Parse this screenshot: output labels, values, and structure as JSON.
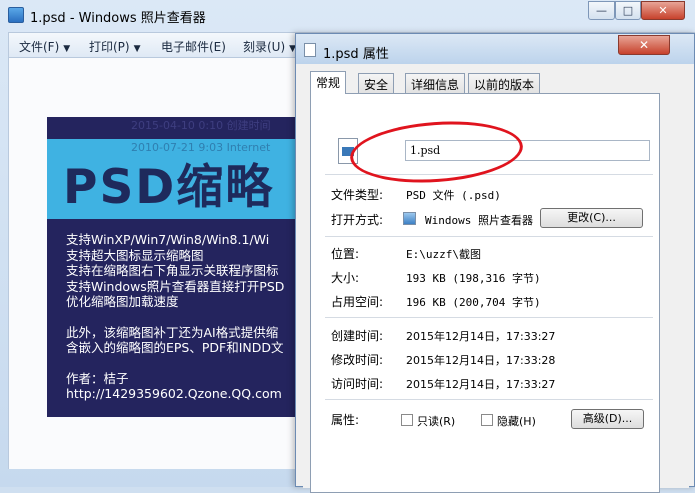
{
  "viewer": {
    "title": "1.psd - Windows 照片查看器",
    "window_buttons": {
      "minimize": "—",
      "maximize": "□",
      "close": "✕"
    },
    "menu": [
      {
        "label": "文件(F)",
        "arrow": "▼"
      },
      {
        "label": "打印(P)",
        "arrow": "▼"
      },
      {
        "label": "电子邮件(E)",
        "arrow": ""
      },
      {
        "label": "刻录(U)",
        "arrow": "▼"
      }
    ]
  },
  "thumbnail": {
    "date1": "2015-04-10 0:10    创建时间",
    "date2": "2010-07-21 9:03    Internet",
    "big_text": "PSD缩略",
    "lines": [
      "支持WinXP/Win7/Win8/Win8.1/Wi",
      "支持超大图标显示缩略图",
      "支持在缩略图右下角显示关联程序图标",
      "支持Windows照片查看器直接打开PSD",
      "优化缩略图加载速度"
    ],
    "lines2": [
      "此外，该缩略图补丁还为AI格式提供缩",
      "含嵌入的缩略图的EPS、PDF和INDD文"
    ],
    "lines3": [
      "作者：桔子",
      "http://1429359602.Qzone.QQ.com"
    ]
  },
  "dialog": {
    "title": "1.psd 属性",
    "close": "✕",
    "tabs": [
      "常规",
      "安全",
      "详细信息",
      "以前的版本"
    ],
    "filename": "1.psd",
    "file_type_label": "文件类型:",
    "file_type_value": "PSD 文件 (.psd)",
    "opens_with_label": "打开方式:",
    "opens_with_value": "Windows 照片查看器",
    "change_button": "更改(C)...",
    "location_label": "位置:",
    "location_value": "E:\\uzzf\\截图",
    "size_label": "大小:",
    "size_value": "193 KB (198,316 字节)",
    "size_on_disk_label": "占用空间:",
    "size_on_disk_value": "196 KB (200,704 字节)",
    "created_label": "创建时间:",
    "created_value": "2015年12月14日，17:33:27",
    "modified_label": "修改时间:",
    "modified_value": "2015年12月14日，17:33:28",
    "accessed_label": "访问时间:",
    "accessed_value": "2015年12月14日，17:33:27",
    "attributes_label": "属性:",
    "readonly_label": "只读(R)",
    "hidden_label": "隐藏(H)",
    "advanced_button": "高级(D)...",
    "annotation_color": "#e0141e"
  }
}
